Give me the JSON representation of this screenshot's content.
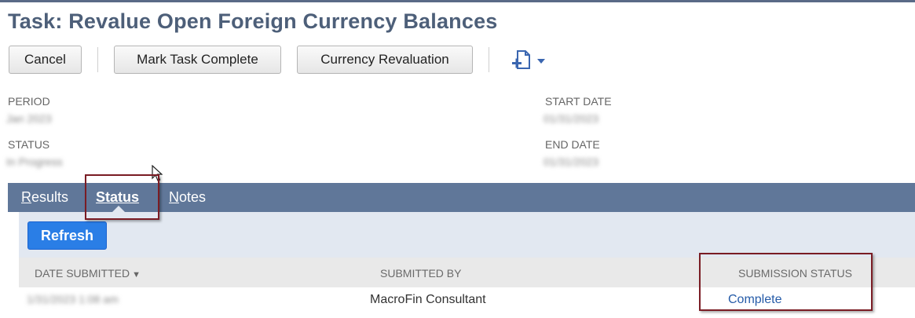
{
  "header": {
    "title": "Task: Revalue Open Foreign Currency Balances"
  },
  "toolbar": {
    "cancel_label": "Cancel",
    "mark_complete_label": "Mark Task Complete",
    "currency_revaluation_label": "Currency Revaluation",
    "new_icon": "new-document-icon"
  },
  "fields": {
    "period_label": "Period",
    "period_value": "Jan 2023",
    "start_date_label": "Start Date",
    "start_date_value": "01/31/2023",
    "status_label": "Status",
    "status_value": "In Progress",
    "end_date_label": "End Date",
    "end_date_value": "01/31/2023"
  },
  "tabs": {
    "results": {
      "first": "R",
      "rest": "esults"
    },
    "status": {
      "first": "S",
      "rest": "tatus"
    },
    "notes": {
      "first": "N",
      "rest": "otes"
    }
  },
  "subtab": {
    "refresh_label": "Refresh"
  },
  "table": {
    "headers": {
      "date_submitted": "Date Submitted",
      "submitted_by": "Submitted By",
      "submission_status": "Submission Status"
    },
    "sort_icon": "sort-desc-icon",
    "rows": [
      {
        "date_submitted": "1/31/2023 1:08 am",
        "submitted_by": "MacroFin Consultant",
        "submission_status": "Complete"
      }
    ]
  },
  "colors": {
    "title": "#4d5f79",
    "tab_bar": "#607799",
    "panel": "#e2e8f1",
    "primary_button": "#2a7ee6",
    "link": "#255ba8",
    "annotation_box": "#7a1c24"
  }
}
